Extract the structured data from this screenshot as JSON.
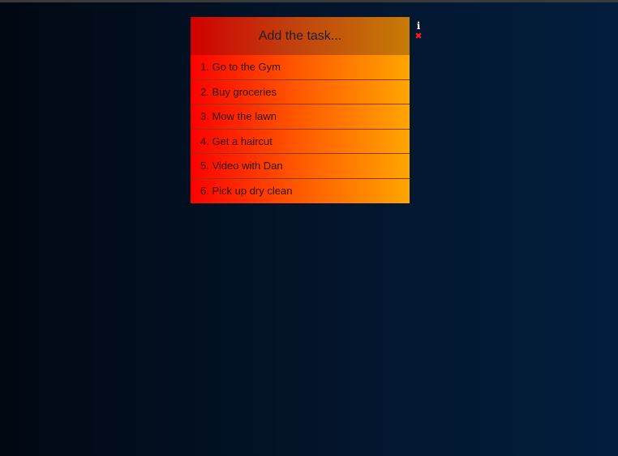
{
  "todo": {
    "input": {
      "placeholder": "Add the task...",
      "value": ""
    },
    "tasks": [
      {
        "label": "1. Go to the Gym"
      },
      {
        "label": "2. Buy groceries"
      },
      {
        "label": "3. Mow the lawn"
      },
      {
        "label": "4. Get a haircut"
      },
      {
        "label": "5. Video with Dan"
      },
      {
        "label": "6. Pick up dry clean"
      }
    ]
  },
  "icons": {
    "info": {
      "name": "info-icon",
      "glyph": "i",
      "color": "#ffffff"
    },
    "close": {
      "name": "close-icon",
      "glyph": "✖",
      "color": "#ff1a1a"
    }
  },
  "colors": {
    "background_left": "#010812",
    "background_right": "#021e3d",
    "header_left": "#d10000",
    "header_right": "#c67c07",
    "item_left": "#ff0000",
    "item_right": "#ffa500"
  }
}
